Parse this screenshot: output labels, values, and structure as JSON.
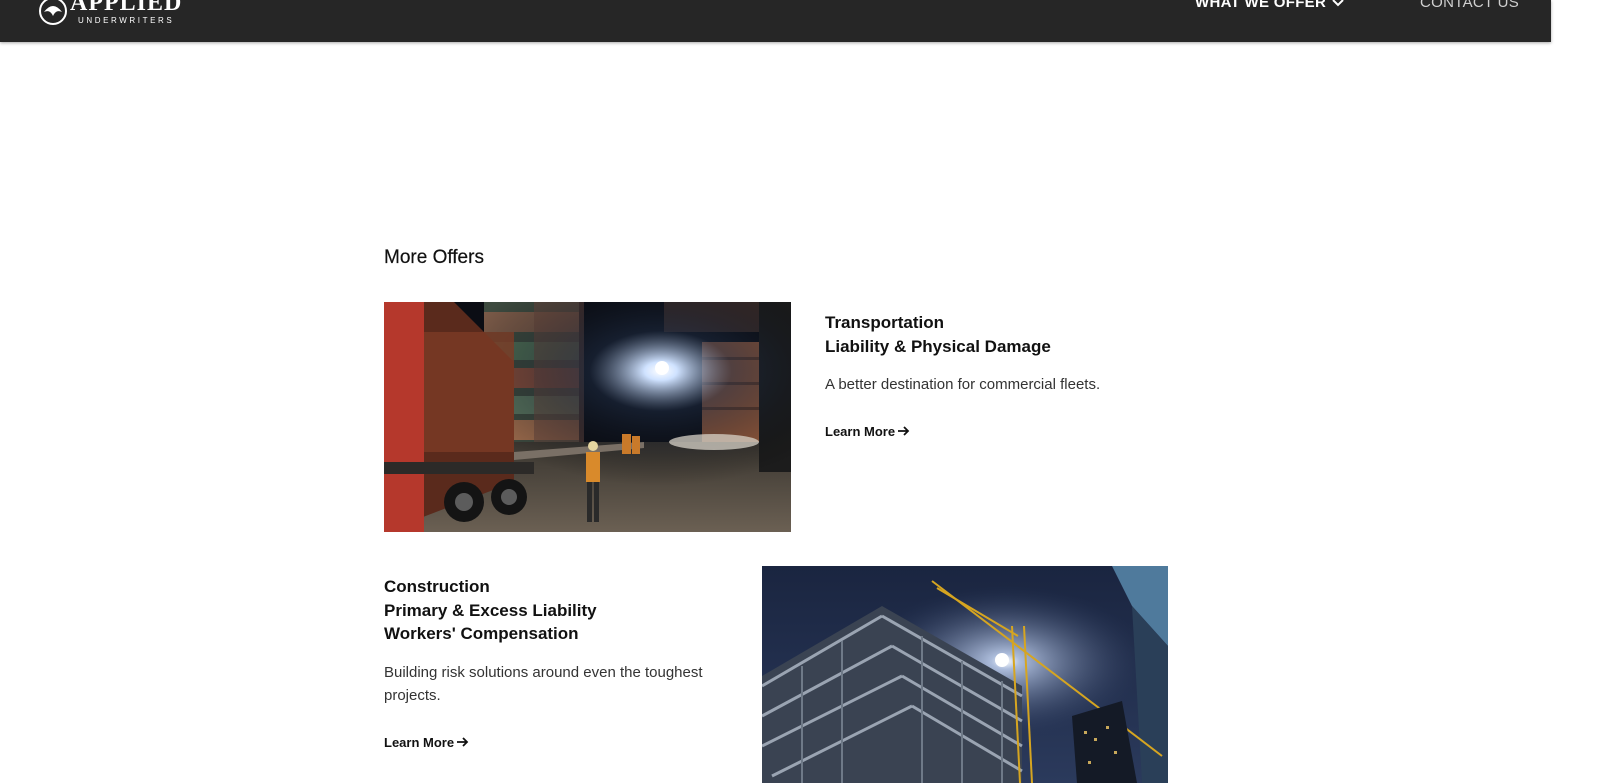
{
  "header": {
    "logo": {
      "word": "APPLIED",
      "sub": "UNDERWRITERS"
    },
    "nav": {
      "what_we_offer": "WHAT WE OFFER",
      "contact_us": "CONTACT US"
    }
  },
  "section": {
    "title": "More Offers"
  },
  "offers": [
    {
      "title_lines": [
        "Transportation",
        "Liability & Physical Damage"
      ],
      "description": "A better destination for commercial fleets.",
      "link": "Learn More",
      "image": "container-yard-truck-night"
    },
    {
      "title_lines": [
        "Construction",
        "Primary & Excess Liability",
        "Workers' Compensation"
      ],
      "description": "Building risk solutions around even the toughest projects.",
      "link": "Learn More",
      "image": "construction-crane-night"
    }
  ],
  "colors": {
    "header_bg": "#262626",
    "text": "#111111",
    "body_text": "#333333"
  }
}
